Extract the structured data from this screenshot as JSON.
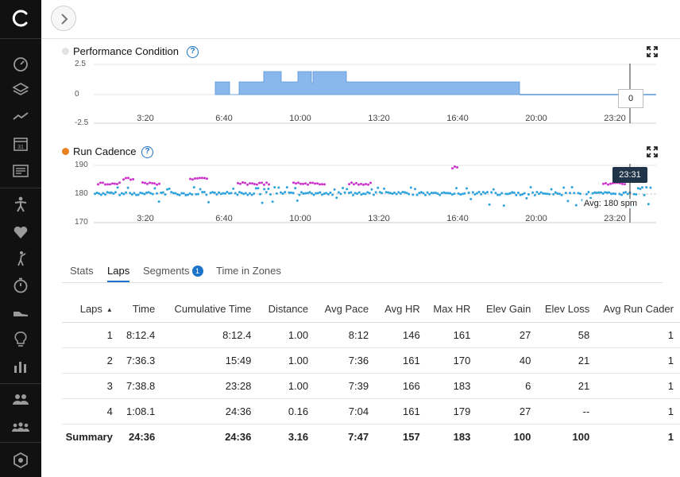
{
  "performance_condition": {
    "title": "Performance Condition",
    "legend_color": "#e2e2e2",
    "fill_color": "#8ab8ec",
    "y_ticks": [
      "2.5",
      "0",
      "-2.5"
    ],
    "x_ticks": [
      "3:20",
      "6:40",
      "10:00",
      "13:20",
      "16:40",
      "20:00",
      "23:20"
    ],
    "tooltip_value": "0"
  },
  "run_cadence": {
    "title": "Run Cadence",
    "legend_color": "#e8821e",
    "y_ticks": [
      "190",
      "180",
      "170"
    ],
    "x_ticks": [
      "3:20",
      "6:40",
      "10:00",
      "13:20",
      "16:40",
      "20:00",
      "23:20"
    ],
    "cursor_time": "23:31",
    "avg_label": "Avg: 180 spm",
    "colors": {
      "normal": "#2fa3dc",
      "high": "#cc33cc"
    }
  },
  "tabs": {
    "stats": "Stats",
    "laps": "Laps",
    "segments": "Segments",
    "segments_count": "1",
    "time_in_zones": "Time in Zones"
  },
  "laps_table": {
    "headers": [
      "Laps",
      "Time",
      "Cumulative Time",
      "Distance",
      "Avg Pace",
      "Avg HR",
      "Max HR",
      "Elev Gain",
      "Elev Loss",
      "Avg Run Cader"
    ],
    "rows": [
      [
        "1",
        "8:12.4",
        "8:12.4",
        "1.00",
        "8:12",
        "146",
        "161",
        "27",
        "58",
        "1"
      ],
      [
        "2",
        "7:36.3",
        "15:49",
        "1.00",
        "7:36",
        "161",
        "170",
        "40",
        "21",
        "1"
      ],
      [
        "3",
        "7:38.8",
        "23:28",
        "1.00",
        "7:39",
        "166",
        "183",
        "6",
        "21",
        "1"
      ],
      [
        "4",
        "1:08.1",
        "24:36",
        "0.16",
        "7:04",
        "161",
        "179",
        "27",
        "--",
        "1"
      ]
    ],
    "summary": [
      "Summary",
      "24:36",
      "24:36",
      "3.16",
      "7:47",
      "157",
      "183",
      "100",
      "100",
      "1"
    ]
  },
  "sidebar": {
    "icons": [
      "dashboard-icon",
      "layers-icon",
      "activity-icon",
      "calendar-icon",
      "news-icon",
      "running-person-icon",
      "heart-icon",
      "golf-icon",
      "stopwatch-icon",
      "shoe-icon",
      "lightbulb-icon",
      "bar-chart-icon",
      "connections-icon",
      "groups-icon",
      "hexagon-icon"
    ]
  }
}
